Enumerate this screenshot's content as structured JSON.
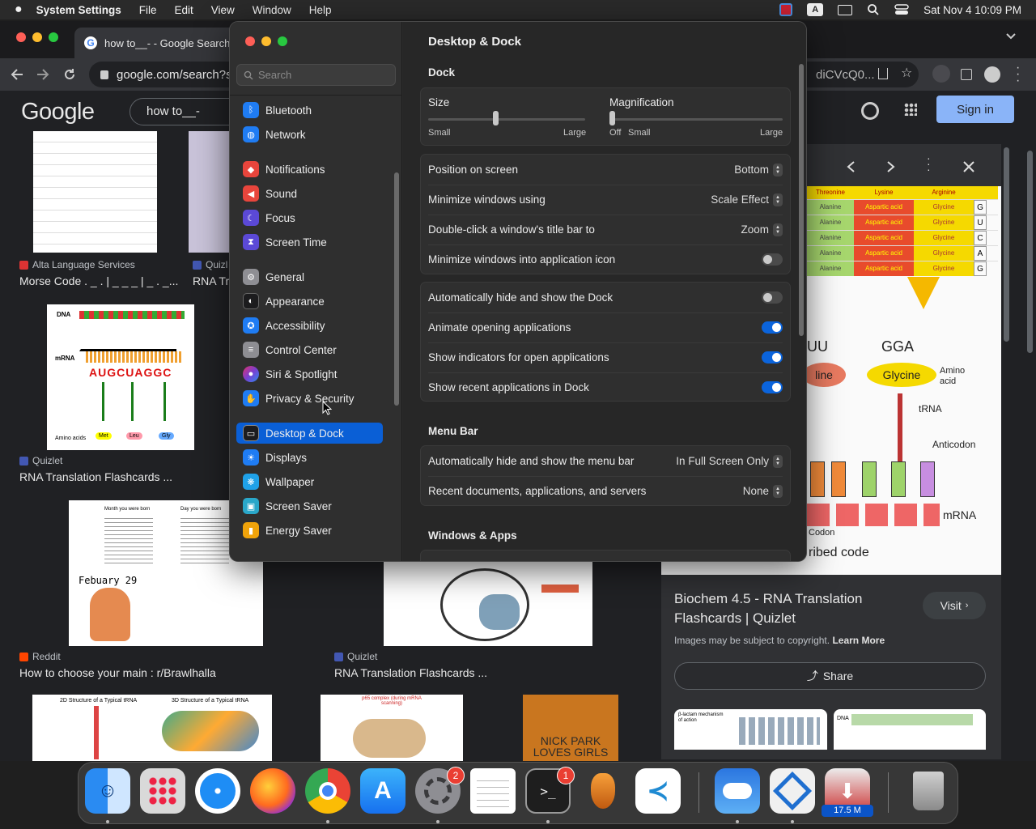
{
  "menubar": {
    "app_name": "System Settings",
    "menus": [
      "File",
      "Edit",
      "View",
      "Window",
      "Help"
    ],
    "clock": "Sat Nov 4  10:09 PM"
  },
  "chrome": {
    "tab_title": "how to__- - Google Search",
    "url": "google.com/search?s",
    "url_tail": "diCVcQ0...",
    "google": {
      "logo": "Google",
      "query": "how to__-",
      "sign_in": "Sign in"
    },
    "results": [
      {
        "source": "Alta Language Services",
        "title": "Morse Code . _ . | _ _ _ | _ . _..."
      },
      {
        "source": "Quizl",
        "title": "RNA Tr"
      },
      {
        "source": "Quizlet",
        "title": "RNA Translation Flashcards ..."
      },
      {
        "source": "Reddit",
        "title": "How to choose your main : r/Brawlhalla"
      },
      {
        "source": "Quizlet",
        "title": "RNA Translation Flashcards ..."
      }
    ],
    "thumb_text": {
      "dna": "DNA",
      "mrna": "mRNA",
      "codon_seq": "AUGCUAGGC",
      "amino_acids": "Amino acids",
      "aa_labels": [
        "Met",
        "Leu",
        "Gly"
      ],
      "birthday_head_left": "Month you were born",
      "birthday_head_right": "Day you were born",
      "february": "Febuary 29",
      "trna_2d": "2D Structure of a Typical tRNA",
      "trna_3d": "3D Structure of a Typical tRNA",
      "p65": "p65 complex (during mRNA scanning)",
      "book": "NICK PARK LOVES GIRLS",
      "beta": "β-lactam mechanism of action",
      "dna_small": "DNA"
    },
    "panel": {
      "title": "Biochem 4.5 - RNA Translation Flashcards | Quizlet",
      "visit": "Visit",
      "copyright": "Images may be subject to copyright.",
      "learn_more": "Learn More",
      "share": "Share",
      "image_text": {
        "headers": [
          "Threonine",
          "Lysine",
          "Arginine"
        ],
        "rows": [
          [
            "Alanine",
            "Aspartic acid",
            "Glycine",
            "G"
          ],
          [
            "Alanine",
            "Aspartic acid",
            "Glycine",
            "U"
          ],
          [
            "Alanine",
            "Aspartic acid",
            "Glycine",
            "C"
          ],
          [
            "Alanine",
            "Aspartic acid",
            "Glycine",
            "A"
          ],
          [
            "Alanine",
            "Aspartic acid",
            "Glycine",
            "G"
          ]
        ],
        "uu": "UU",
        "gga": "GGA",
        "line": "line",
        "glycine": "Glycine",
        "amino_acid": "Amino acid",
        "trna": "tRNA",
        "anticodon": "Anticodon",
        "mrna": "mRNA",
        "codon": "Codon",
        "caption": "ribed code"
      }
    }
  },
  "settings": {
    "search_placeholder": "Search",
    "sidebar": [
      {
        "label": "Bluetooth",
        "icon": "bluetooth-icon",
        "color": "#1f7cf3"
      },
      {
        "label": "Network",
        "icon": "globe-icon",
        "color": "#1f7cf3"
      },
      {
        "label": "Notifications",
        "icon": "bell-icon",
        "color": "#e8453c"
      },
      {
        "label": "Sound",
        "icon": "speaker-icon",
        "color": "#e8453c"
      },
      {
        "label": "Focus",
        "icon": "moon-icon",
        "color": "#5b49d6"
      },
      {
        "label": "Screen Time",
        "icon": "hourglass-icon",
        "color": "#5b49d6"
      },
      {
        "label": "General",
        "icon": "gear-icon",
        "color": "#8e8e93"
      },
      {
        "label": "Appearance",
        "icon": "appearance-icon",
        "color": "#1c1c1e"
      },
      {
        "label": "Accessibility",
        "icon": "accessibility-icon",
        "color": "#1f7cf3"
      },
      {
        "label": "Control Center",
        "icon": "control-center-icon",
        "color": "#8e8e93"
      },
      {
        "label": "Siri & Spotlight",
        "icon": "siri-icon",
        "color": "#7a3fd1"
      },
      {
        "label": "Privacy & Security",
        "icon": "hand-icon",
        "color": "#1f7cf3"
      },
      {
        "label": "Desktop & Dock",
        "icon": "dock-icon",
        "color": "#1c1c1e"
      },
      {
        "label": "Displays",
        "icon": "sun-icon",
        "color": "#1f7cf3"
      },
      {
        "label": "Wallpaper",
        "icon": "wallpaper-icon",
        "color": "#1fa1e8"
      },
      {
        "label": "Screen Saver",
        "icon": "screensaver-icon",
        "color": "#2aa7c9"
      },
      {
        "label": "Energy Saver",
        "icon": "battery-icon",
        "color": "#f0a30a"
      }
    ],
    "selected": "Desktop & Dock",
    "page_title": "Desktop & Dock",
    "dock_section": "Dock",
    "size": {
      "label": "Size",
      "min": "Small",
      "max": "Large",
      "value_fraction": 0.43
    },
    "magnification": {
      "label": "Magnification",
      "off": "Off",
      "min": "Small",
      "max": "Large",
      "value_fraction": 0.0
    },
    "popups": [
      {
        "label": "Position on screen",
        "value": "Bottom"
      },
      {
        "label": "Minimize windows using",
        "value": "Scale Effect"
      },
      {
        "label": "Double-click a window's title bar to",
        "value": "Zoom"
      }
    ],
    "minimize_into_icon": {
      "label": "Minimize windows into application icon",
      "on": false
    },
    "toggles": [
      {
        "label": "Automatically hide and show the Dock",
        "on": false
      },
      {
        "label": "Animate opening applications",
        "on": true
      },
      {
        "label": "Show indicators for open applications",
        "on": true
      },
      {
        "label": "Show recent applications in Dock",
        "on": true
      }
    ],
    "menubar_section": "Menu Bar",
    "menubar_rows": [
      {
        "label": "Automatically hide and show the menu bar",
        "value": "In Full Screen Only"
      },
      {
        "label": "Recent documents, applications, and servers",
        "value": "None"
      }
    ],
    "windows_section": "Windows & Apps"
  },
  "dock": {
    "apps": [
      "finder-icon",
      "launchpad-icon",
      "safari-icon",
      "firefox-icon",
      "chrome-icon",
      "app-store-icon",
      "system-settings-icon",
      "textedit-icon",
      "terminal-icon",
      "garageband-icon",
      "vscode-icon",
      "weather-icon",
      "remote-desktop-icon",
      "downloads-icon",
      "trash-icon"
    ],
    "settings_badge": "2",
    "terminal_badge": "1",
    "download_size": "17.5 M"
  }
}
